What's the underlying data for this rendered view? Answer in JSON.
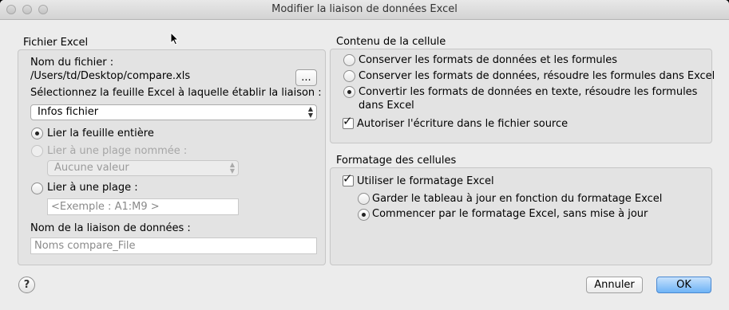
{
  "window": {
    "title": "Modifier la liaison de données Excel"
  },
  "left": {
    "group_title": "Fichier Excel",
    "file_name_label": "Nom du fichier :",
    "file_path": "/Users/td/Desktop/compare.xls",
    "browse_label": "...",
    "sheet_prompt": "Sélectionnez la feuille Excel à laquelle établir la liaison :",
    "sheet_select": "Infos fichier",
    "option_whole_sheet": "Lier la feuille entière",
    "option_named_range": "Lier à une plage nommée :",
    "named_range_select": "Aucune valeur",
    "option_range": "Lier à une plage :",
    "range_placeholder": "<Exemple : A1:M9 >",
    "link_name_label": "Nom de la liaison de données :",
    "link_name_value": "Noms compare_File"
  },
  "cell_content": {
    "group_title": "Contenu de la cellule",
    "option_keep_formats": "Conserver les formats de données et les formules",
    "option_resolve_formulas": "Conserver les formats de données, résoudre les formules dans Excel",
    "option_convert_line1": "Convertir les formats de données en texte, résoudre les formules",
    "option_convert_line2": "dans Excel",
    "allow_write_label": "Autoriser l'écriture dans le fichier source"
  },
  "cell_formatting": {
    "group_title": "Formatage des cellules",
    "use_excel_formatting": "Utiliser le formatage Excel",
    "option_keep_updated": "Garder le tableau à jour en fonction du formatage Excel",
    "option_start_with": "Commencer par le formatage Excel, sans mise à jour"
  },
  "footer": {
    "help_label": "?",
    "cancel_label": "Annuler",
    "ok_label": "OK"
  }
}
